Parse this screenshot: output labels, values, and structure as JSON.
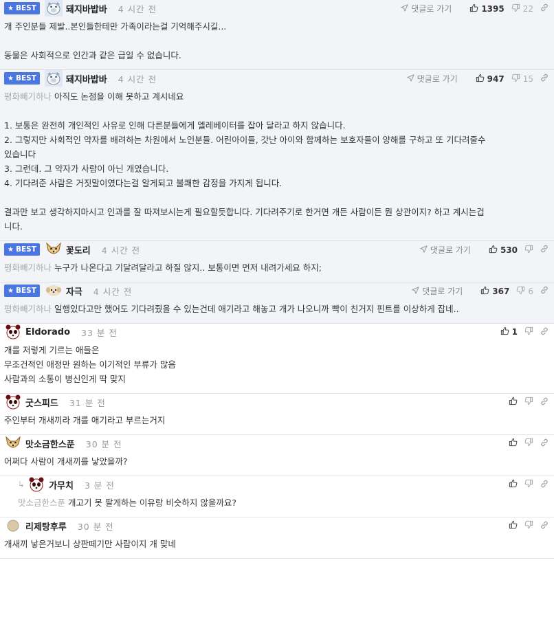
{
  "labels": {
    "best": "BEST",
    "goto_comment": "댓글로 가기"
  },
  "colors": {
    "best_badge": "#4a76e0",
    "best_bg": "#f2f4f7"
  },
  "comments": [
    {
      "best": true,
      "avatar": "pig-icon",
      "nick": "돼지바밥바",
      "time": "4 시간 전",
      "goto": true,
      "up": "1395",
      "down": "22",
      "mention": "",
      "lines": [
        "개 주인분들 제발..본인들한테만 가족이라는걸 기억해주시길...",
        "",
        "동물은 사회적으로 인간과 같은 급일 수 없습니다."
      ]
    },
    {
      "best": true,
      "avatar": "pig-icon",
      "nick": "돼지바밥바",
      "time": "4 시간 전",
      "goto": true,
      "up": "947",
      "down": "15",
      "mention": "평화빼기하나",
      "lines": [
        "아직도 논점을 이해 못하고 계시네요",
        "",
        "1. 보통은 완전히 개인적인 사유로 인해 다른분들에게 엘레베이터를 잡아 달라고 하지 않습니다.",
        "2. 그렇지만 사회적인 약자를 배려하는 차원에서 노인분들. 어린아이들, 갓난 아이와 함께하는 보호자들이 양해를 구하고 또 기다려줄수",
        "있습니다",
        "3. 그런데. 그 약자가 사람이 아닌 개였습니다.",
        "4. 기다려준 사람은 거짓말이였다는걸 알게되고 불쾌한 감정을 가지게 됩니다.",
        "",
        "결과만 보고 생각하지마시고 인과를 잘 따져보시는게 필요할듯합니다. 기다려주기로 한거면 개든 사람이든 뭔 상관이지? 하고 계시는겁",
        "니다."
      ]
    },
    {
      "best": true,
      "avatar": "dog-icon",
      "nick": "꽃도리",
      "time": "4 시간 전",
      "goto": true,
      "up": "530",
      "down": "",
      "mention": "평화빼기하나",
      "lines": [
        "누구가 나온다고 기달려달라고 하질 않지.. 보통이면 먼저 내려가세요 하지;"
      ]
    },
    {
      "best": true,
      "avatar": "puppy-icon",
      "nick": "자극",
      "time": "4 시간 전",
      "goto": true,
      "up": "367",
      "down": "6",
      "mention": "평화빼기하나",
      "lines": [
        "일행있다고만 했어도 기다려줬을 수 있는건데 애기라고 해놓고 개가 나오니까 빡이 친거지 핀트를 이상하게 잡네.."
      ]
    },
    {
      "best": false,
      "avatar": "panda-icon",
      "nick": "Eldorado",
      "time": "33 분 전",
      "goto": false,
      "up": "1",
      "down": "",
      "mention": "",
      "lines": [
        "개를 저렇게 기르는 애들은",
        "무조건적인 애정만 원하는 이기적인 부류가 많음",
        "사람과의 소통이 병신인게 딱 맞지"
      ]
    },
    {
      "best": false,
      "avatar": "panda-icon",
      "nick": "굿스피드",
      "time": "31 분 전",
      "goto": false,
      "up": "",
      "down": "",
      "mention": "",
      "lines": [
        "주인부터 개새끼라 개를 애기라고 부르는거지"
      ]
    },
    {
      "best": false,
      "avatar": "dog-icon",
      "nick": "맛소금한스푼",
      "time": "30 분 전",
      "goto": false,
      "up": "",
      "down": "",
      "mention": "",
      "lines": [
        "어쩌다 사람이 개새끼를 낳았을까?"
      ]
    },
    {
      "best": false,
      "reply": true,
      "avatar": "panda-icon",
      "nick": "가무치",
      "time": "3 분 전",
      "goto": false,
      "up": "",
      "down": "",
      "mention": "맛소금한스푼",
      "lines": [
        "개고기 못 팔게하는 이유랑 비슷하지 않을까요?"
      ]
    },
    {
      "best": false,
      "avatar": "circle-icon",
      "nick": "리제탕후루",
      "time": "30 분 전",
      "goto": false,
      "up": "",
      "down": "",
      "mention": "",
      "lines": [
        "개새끼 낳은거보니 상판떼기만 사람이지 개 맞네"
      ]
    }
  ]
}
